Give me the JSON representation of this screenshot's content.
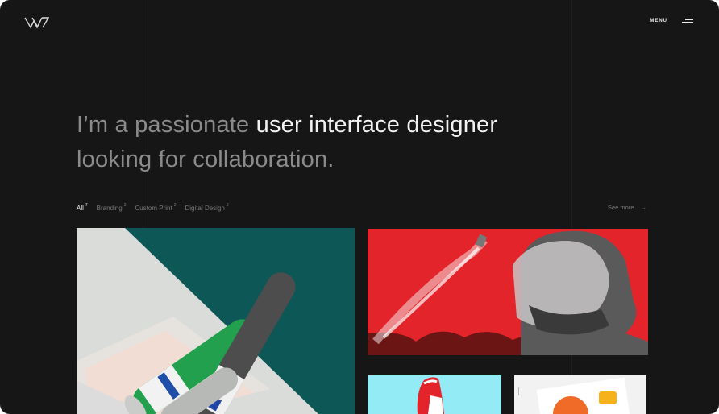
{
  "header": {
    "logo_icon": "w-monogram-icon",
    "menu_label": "MENU",
    "menu_icon": "hamburger-icon"
  },
  "hero": {
    "line1_muted": "I’m a passionate ",
    "line1_bright": "user interface designer",
    "line2": "looking for collaboration."
  },
  "filters": [
    {
      "label": "All",
      "count": "7"
    },
    {
      "label": "Branding",
      "count": "2"
    },
    {
      "label": "Custom Print",
      "count": "2"
    },
    {
      "label": "Digital Design",
      "count": "2"
    }
  ],
  "see_more": {
    "label": "See more",
    "arrow": "→"
  },
  "colors": {
    "background": "#161616",
    "text_bright": "#f2f2f2",
    "text_muted": "#8b8b8b",
    "accent_red": "#e4242b",
    "accent_teal": "#0f5a5a",
    "accent_green": "#26a14f",
    "accent_cyan": "#93ecf5"
  },
  "portfolio_cards": [
    {
      "name": "poster-tubes",
      "type": "image"
    },
    {
      "name": "riot-helmet",
      "type": "image"
    },
    {
      "name": "red-sneaker",
      "type": "image"
    },
    {
      "name": "packaging",
      "type": "image"
    }
  ]
}
